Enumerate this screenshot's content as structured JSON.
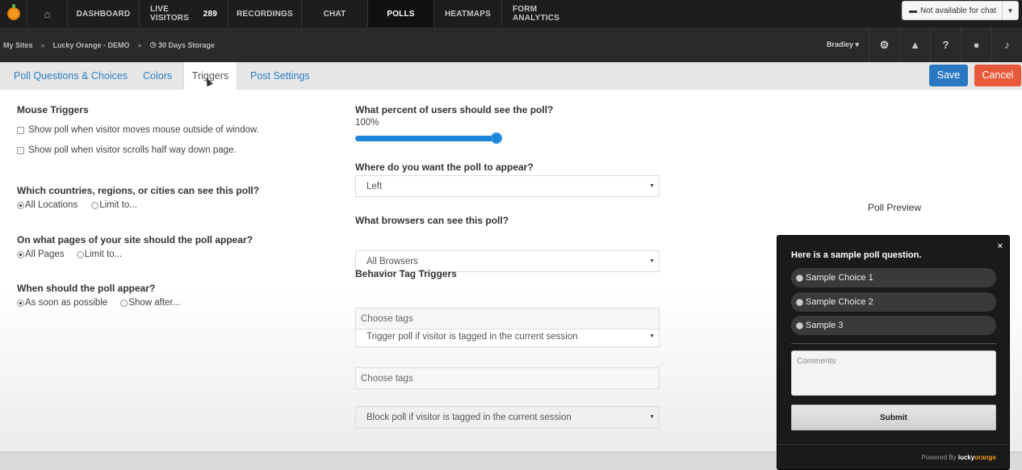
{
  "topnav": {
    "items": [
      {
        "label": "DASHBOARD"
      },
      {
        "label": "LIVE VISITORS",
        "count": "289"
      },
      {
        "label": "RECORDINGS"
      },
      {
        "label": "CHAT"
      },
      {
        "label": "POLLS"
      },
      {
        "label": "HEATMAPS"
      },
      {
        "label": "FORM ANALYTICS"
      }
    ],
    "chat_status": "Not available for chat"
  },
  "subbar": {
    "crumbs": [
      "My Sites",
      "Lucky Orange - DEMO",
      "30 Days Storage"
    ],
    "user": "Bradley"
  },
  "tabs": [
    {
      "label": "Poll Questions & Choices"
    },
    {
      "label": "Colors"
    },
    {
      "label": "Triggers"
    },
    {
      "label": "Post Settings"
    }
  ],
  "actions": {
    "save": "Save",
    "cancel": "Cancel"
  },
  "left": {
    "mouse_heading": "Mouse Triggers",
    "mouse_options": [
      "Show poll when visitor moves mouse outside of window.",
      "Show poll when visitor scrolls half way down page."
    ],
    "countries_heading": "Which countries, regions, or cities can see this poll?",
    "countries_options": [
      "All Locations",
      "Limit to..."
    ],
    "pages_heading": "On what pages of your site should the poll appear?",
    "pages_options": [
      "All Pages",
      "Limit to..."
    ],
    "when_heading": "When should the poll appear?",
    "when_options": [
      "As soon as possible",
      "Show after..."
    ]
  },
  "middle": {
    "percent_heading": "What percent of users should see the poll?",
    "percent_value": "100%",
    "percent_level": 1.0,
    "position_heading": "Where do you want the poll to appear?",
    "position_value": "Left",
    "browsers_heading": "What browsers can see this poll?",
    "browsers_value": "All Browsers",
    "behavior_heading": "Behavior Tag Triggers",
    "trigger_select": "Trigger poll if visitor is tagged in the current session",
    "trigger_tags_placeholder": "Choose tags",
    "block_select": "Block poll if visitor is tagged in the current session",
    "block_tags_placeholder": "Choose tags"
  },
  "preview": {
    "title": "Poll Preview",
    "close": "×",
    "question": "Here is a sample poll question.",
    "choices": [
      "Sample Choice 1",
      "Sample Choice 2",
      "Sample 3"
    ],
    "comments_placeholder": "Comments",
    "submit": "Submit",
    "powered_by": "Powered By",
    "brand_lucky": "lucky",
    "brand_orange": "orange"
  }
}
